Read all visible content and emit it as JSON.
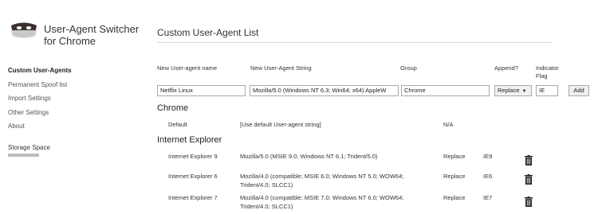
{
  "app": {
    "title": "User-Agent Switcher for Chrome",
    "logo_icon": "mask-logo-icon"
  },
  "sidebar": {
    "items": [
      {
        "label": "Custom User-Agents",
        "active": true
      },
      {
        "label": "Permanent Spoof list",
        "active": false
      },
      {
        "label": "Import Settings",
        "active": false
      },
      {
        "label": "Other Settings",
        "active": false
      },
      {
        "label": "About",
        "active": false
      }
    ],
    "storage_label": "Storage Space"
  },
  "main": {
    "title": "Custom User-Agent List",
    "columns": {
      "name": "New User-agent name",
      "string": "New User-Agent String",
      "group": "Group",
      "append": "Append?",
      "flag": "Indicator Flag"
    },
    "form": {
      "name_value": "Netflix Linux",
      "string_value": "Mozilla/5.0 (Windows NT 6.3; Win64; x64) AppleW",
      "group_value": "Chrome",
      "append_value": "Replace",
      "flag_value": "IE",
      "add_label": "Add"
    },
    "groups": [
      {
        "name": "Chrome",
        "rows": [
          {
            "name": "Default",
            "string": "[Use default User-agent string]",
            "append": "N/A",
            "flag": ""
          }
        ]
      },
      {
        "name": "Internet Explorer",
        "rows": [
          {
            "name": "Internet Explorer 9",
            "string": "Mozilla/5.0 (MSIE 9.0; Windows NT 6.1; Trident/5.0)",
            "string2": "",
            "append": "Replace",
            "flag": "IE9",
            "delete_icon": "trash-icon"
          },
          {
            "name": "Internet Explorer 6",
            "string": "Mozilla/4.0 (compatible; MSIE 6.0; Windows NT 5.0; WOW64;",
            "string2": "Trident/4.0; SLCC1)",
            "append": "Replace",
            "flag": "IE6",
            "delete_icon": "trash-icon"
          },
          {
            "name": "Internet Explorer 7",
            "string": "Mozilla/4.0 (compatible; MSIE 7.0; Windows NT 6.0; WOW64;",
            "string2": "Trident/4.0; SLCC1)",
            "append": "Replace",
            "flag": "IE7",
            "delete_icon": "trash-icon"
          }
        ]
      }
    ]
  }
}
